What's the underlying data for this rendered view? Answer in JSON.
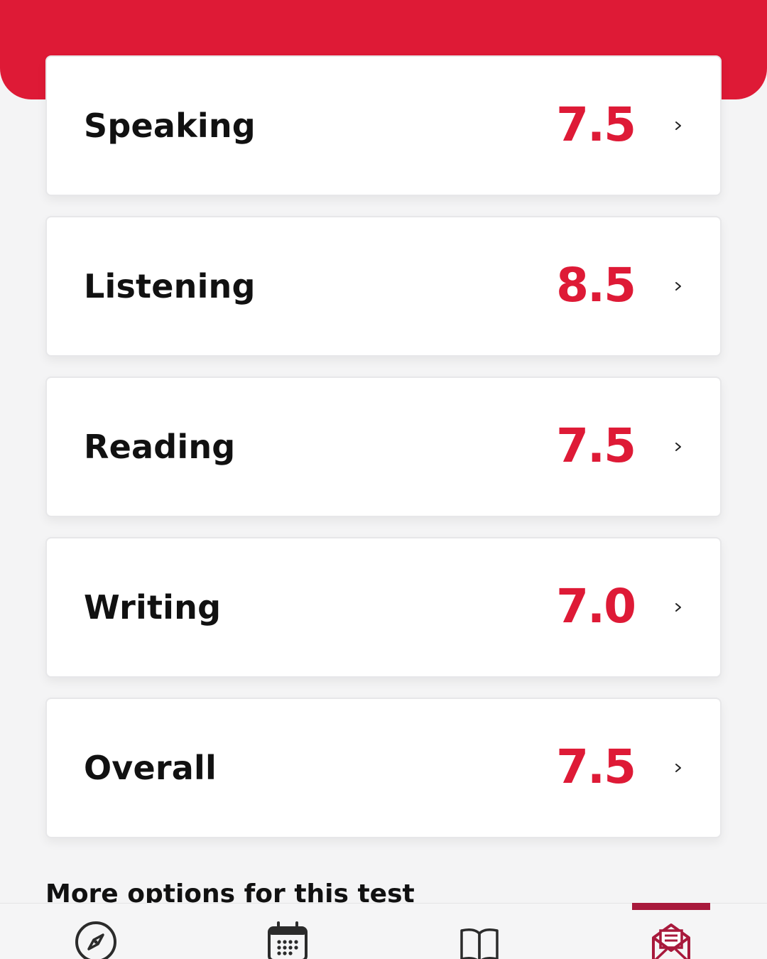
{
  "header": {
    "accent_color": "#de1a36"
  },
  "scores": [
    {
      "label": "Speaking",
      "value": "7.5"
    },
    {
      "label": "Listening",
      "value": "8.5"
    },
    {
      "label": "Reading",
      "value": "7.5"
    },
    {
      "label": "Writing",
      "value": "7.0"
    },
    {
      "label": "Overall",
      "value": "7.5"
    }
  ],
  "section": {
    "more_options_title": "More options for this test"
  },
  "tabbar": {
    "items": [
      {
        "icon": "compass-icon",
        "selected": false
      },
      {
        "icon": "calendar-icon",
        "selected": false
      },
      {
        "icon": "book-icon",
        "selected": false
      },
      {
        "icon": "mail-icon",
        "selected": true
      }
    ],
    "selected_color": "#a8193c"
  }
}
